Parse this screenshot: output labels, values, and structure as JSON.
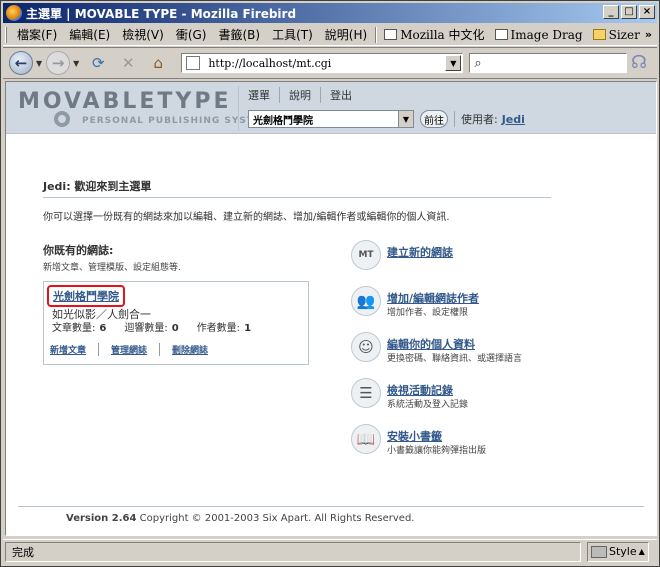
{
  "window": {
    "title": "主選單 | MOVABLE TYPE - Mozilla Firebird"
  },
  "menubar": {
    "items": [
      "檔案(F)",
      "編輯(E)",
      "檢視(V)",
      "衝(G)",
      "書籤(B)",
      "工具(T)",
      "說明(H)"
    ],
    "extras": [
      "Mozilla 中文化",
      "Image Drag",
      "Sizer"
    ],
    "more": "»"
  },
  "navbar": {
    "url": "http://localhost/mt.cgi",
    "search_placeholder": ""
  },
  "mt_header": {
    "logo_main": "MOVABLETYPE",
    "logo_sub": "PERSONAL PUBLISHING SYSTEM",
    "nav_links": [
      "選單",
      "說明",
      "登出"
    ],
    "blog_select": "光劍格鬥學院",
    "go_label": "前往",
    "user_label": "使用者:",
    "user_name": "Jedi"
  },
  "main": {
    "welcome": "Jedi: 歡迎來到主選單",
    "intro": "你可以選擇一份既有的網誌來加以編輯、建立新的網誌、增加/編輯作者或編輯你的個人資訊.",
    "blogs_heading": "你既有的網誌:",
    "blogs_sub": "新增文章、管理模版、設定組態等.",
    "blog": {
      "name": "光劍格鬥學院",
      "description": "如光似影／人劍合一",
      "stats": [
        {
          "label": "文章數量:",
          "value": "6"
        },
        {
          "label": "迴響數量:",
          "value": "0"
        },
        {
          "label": "作者數量:",
          "value": "1"
        }
      ],
      "actions": [
        "新增文章",
        "管理網誌",
        "刪除網誌"
      ]
    },
    "actions": [
      {
        "title": "建立新的網誌",
        "desc": "",
        "icon": "mt-icon"
      },
      {
        "title": "增加/編輯網誌作者",
        "desc": "增加作者、設定權限",
        "icon": "users-icon"
      },
      {
        "title": "編輯你的個人資料",
        "desc": "更換密碼、聯絡資訊、或選擇語言",
        "icon": "profile-icon"
      },
      {
        "title": "檢視活動記錄",
        "desc": "系統活動及登入記錄",
        "icon": "log-icon"
      },
      {
        "title": "安裝小書籤",
        "desc": "小書籤讓你能夠彈指出版",
        "icon": "bookmarklet-icon"
      }
    ]
  },
  "footer": {
    "version": "Version 2.64",
    "copyright": "Copyright © 2001-2003 Six Apart. All Rights Reserved."
  },
  "statusbar": {
    "status": "完成",
    "style_label": "Style"
  },
  "colors": {
    "link": "#33598a",
    "highlight_border": "#e8101a",
    "header_bg": "#cfd8e0"
  }
}
